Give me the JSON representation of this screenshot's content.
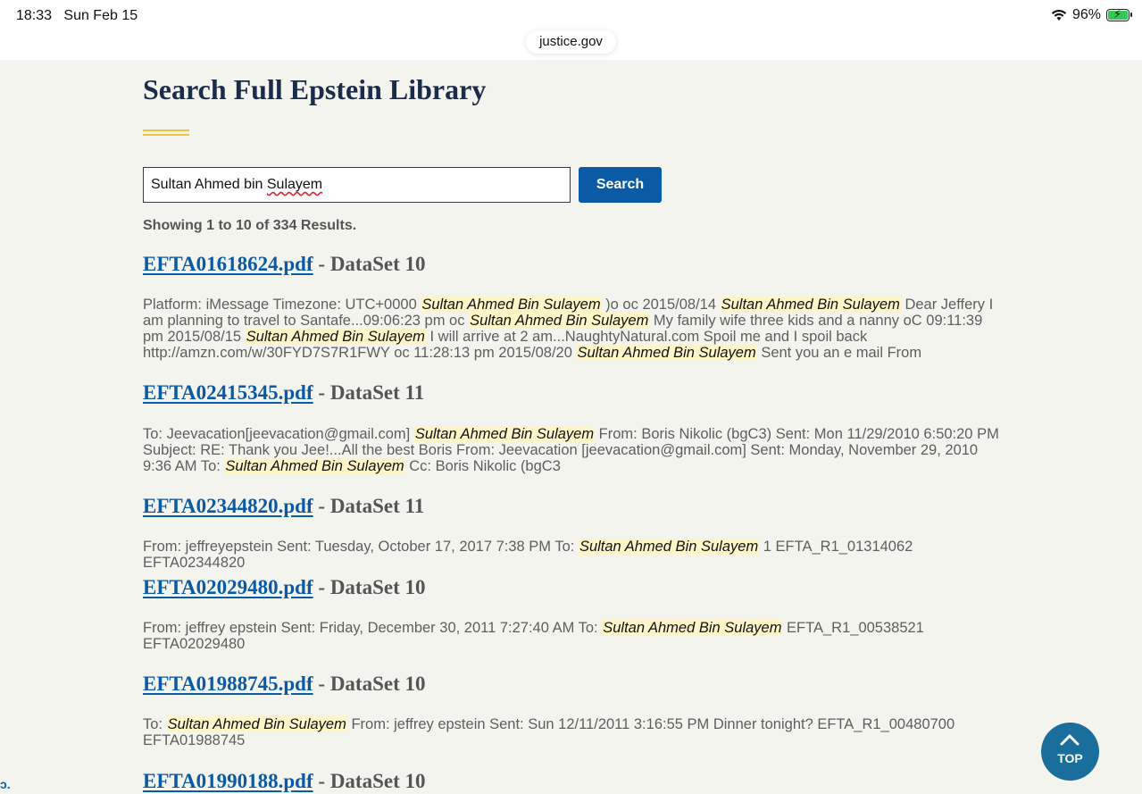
{
  "status_bar": {
    "time": "18:33",
    "date": "Sun Feb 15",
    "battery": "96%"
  },
  "browser": {
    "url": "justice.gov"
  },
  "page": {
    "title": "Search Full Epstein Library",
    "search": {
      "value_plain": "Sultan Ahmed bin ",
      "value_misspelled": "Sulayem",
      "button_label": "Search"
    },
    "results_count": "Showing 1 to 10 of 334 Results.",
    "results": [
      {
        "file": "EFTA01618624.pdf",
        "dataset": "DataSet 10",
        "snippet": [
          {
            "t": "Platform: iMessage Timezone: UTC+0000 "
          },
          {
            "h": "Sultan Ahmed Bin Sulayem"
          },
          {
            "t": " )o oc 2015/08/14 "
          },
          {
            "h": "Sultan Ahmed Bin Sulayem"
          },
          {
            "t": " Dear Jeffery I am planning to travel to Santafe...09:06:23 pm oc "
          },
          {
            "h": "Sultan Ahmed Bin Sulayem"
          },
          {
            "t": " My family wife three kids and a nanny oC 09:11:39 pm 2015/08/15 "
          },
          {
            "h": "Sultan Ahmed Bin Sulayem"
          },
          {
            "t": " I will arrive at 2 am...NaughtyNatural.com Spoil me and I spoil back http://amzn.com/w/30FYD7S7R1FWY oc 11:28:13 pm 2015/08/20 "
          },
          {
            "h": "Sultan Ahmed Bin Sulayem"
          },
          {
            "t": " Sent you an e mail From"
          }
        ]
      },
      {
        "file": "EFTA02415345.pdf",
        "dataset": "DataSet 11",
        "snippet": [
          {
            "t": "To: Jeevacation[jeevacation@gmail.com] "
          },
          {
            "h": "Sultan Ahmed Bin Sulayem"
          },
          {
            "t": " From: Boris Nikolic (bgC3) Sent: Mon 11/29/2010 6:50:20 PM Subject: RE: Thank you Jee!...All the best Boris From: Jeevacation [jeevacation@gmail.com] Sent: Monday, November 29, 2010 9:36 AM To: "
          },
          {
            "h": "Sultan Ahmed Bin Sulayem"
          },
          {
            "t": " Cc: Boris Nikolic (bgC3"
          }
        ]
      },
      {
        "file": "EFTA02344820.pdf",
        "dataset": "DataSet 11",
        "snippet": [
          {
            "t": "From: jeffreyepstein Sent: Tuesday, October 17, 2017 7:38 PM To: "
          },
          {
            "h": "Sultan Ahmed Bin Sulayem"
          },
          {
            "t": " 1 EFTA_R1_01314062 EFTA02344820"
          }
        ]
      },
      {
        "file": "EFTA02029480.pdf",
        "dataset": "DataSet 10",
        "snippet": [
          {
            "t": "From: jeffrey epstein Sent: Friday, December 30, 2011 7:27:40 AM To: "
          },
          {
            "h": "Sultan Ahmed Bin Sulayem"
          },
          {
            "t": " EFTA_R1_00538521 EFTA02029480"
          }
        ]
      },
      {
        "file": "EFTA01988745.pdf",
        "dataset": "DataSet 10",
        "snippet": [
          {
            "t": "To: "
          },
          {
            "h": "Sultan Ahmed Bin Sulayem"
          },
          {
            "t": " From: jeffrey epstein Sent: Sun 12/11/2011 3:16:55 PM Dinner tonight? EFTA_R1_00480700 EFTA01988745"
          }
        ]
      },
      {
        "file": "EFTA01990188.pdf",
        "dataset": "DataSet 10",
        "snippet": []
      }
    ],
    "separator": " - ",
    "top_button_label": "TOP"
  },
  "edge_fragment": "ɔ."
}
